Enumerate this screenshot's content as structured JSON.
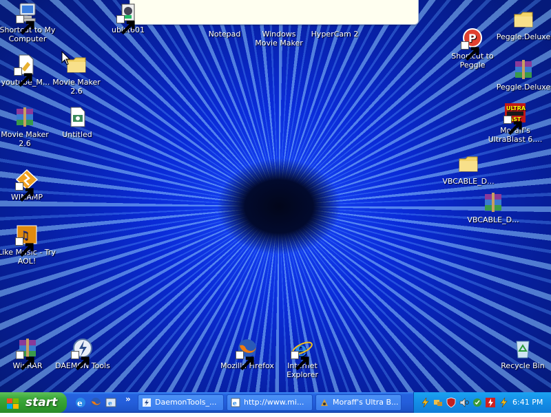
{
  "desktop": {
    "icons": [
      {
        "label": "Shortcut to My Computer",
        "icon": "my-computer-icon"
      },
      {
        "label": "ublst601",
        "icon": "installer-icon"
      },
      {
        "label": "Notepad",
        "icon": "notepad-icon"
      },
      {
        "label": "Windows Movie Maker",
        "icon": "movie-maker-icon"
      },
      {
        "label": "HyperCam 2",
        "icon": "hypercam-icon"
      },
      {
        "label": "Peggle.Deluxe",
        "icon": "folder-icon"
      },
      {
        "label": "youtube_M...",
        "icon": "document-icon"
      },
      {
        "label": "Movie Maker 2.6",
        "icon": "folder-icon"
      },
      {
        "label": "Shortcut to Peggle",
        "icon": "peggle-icon"
      },
      {
        "label": "Peggle.Deluxe",
        "icon": "winrar-archive-icon"
      },
      {
        "label": "Movie Maker 2.6",
        "icon": "winrar-archive-icon"
      },
      {
        "label": "Untitled",
        "icon": "movie-project-icon"
      },
      {
        "label": "Moraff's UltraBlast 6....",
        "icon": "ultrablast-icon"
      },
      {
        "label": "WINAMP",
        "icon": "winamp-icon"
      },
      {
        "label": "VBCABLE_D...",
        "icon": "folder-icon"
      },
      {
        "label": "VBCABLE_D...",
        "icon": "winrar-archive-icon"
      },
      {
        "label": "Like Music - Try AOL!",
        "icon": "aol-music-icon"
      },
      {
        "label": "WinRAR",
        "icon": "winrar-icon"
      },
      {
        "label": "DAEMON Tools",
        "icon": "daemon-tools-icon"
      },
      {
        "label": "Mozilla Firefox",
        "icon": "firefox-icon"
      },
      {
        "label": "Internet Explorer",
        "icon": "internet-explorer-icon"
      },
      {
        "label": "Recycle Bin",
        "icon": "recycle-bin-icon"
      }
    ]
  },
  "taskbar": {
    "start_label": "start",
    "quick_launch": [
      "ie-icon",
      "firefox-icon",
      "ie-browser-icon"
    ],
    "chevron": "»",
    "tasks": [
      {
        "label": "DaemonTools_...",
        "icon": "daemon-tools-icon"
      },
      {
        "label": "http://www.mi...",
        "icon": "internet-explorer-icon"
      },
      {
        "label": "Moraff's Ultra B...",
        "icon": "ultrablast-icon"
      }
    ],
    "clock": "6:41 PM"
  },
  "colors": {
    "taskbar": "#245edb",
    "start": "#3da93b",
    "tray": "#138de6"
  }
}
